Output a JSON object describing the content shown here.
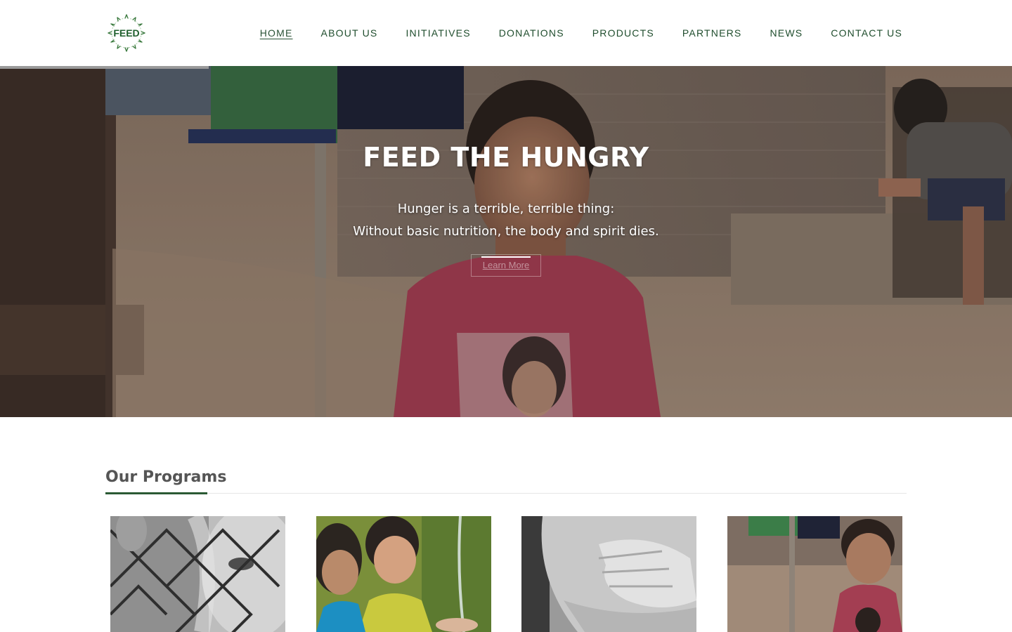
{
  "brand": {
    "logo_text": "FEED",
    "accent": "#2b5a34"
  },
  "nav": {
    "items": [
      {
        "label": "HOME",
        "active": true
      },
      {
        "label": "ABOUT US"
      },
      {
        "label": "INITIATIVES"
      },
      {
        "label": "DONATIONS"
      },
      {
        "label": "PRODUCTS"
      },
      {
        "label": "PARTNERS"
      },
      {
        "label": "NEWS"
      },
      {
        "label": "CONTACT US"
      }
    ]
  },
  "hero": {
    "title": "FEED THE HUNGRY",
    "line1": "Hunger is a terrible, terrible thing:",
    "line2": "Without basic nutrition, the body and spirit dies.",
    "button_label": "Learn More"
  },
  "programs": {
    "heading": "Our Programs"
  },
  "colors": {
    "nav_text": "#1f4d2d",
    "rule": "#e6e6e6"
  }
}
